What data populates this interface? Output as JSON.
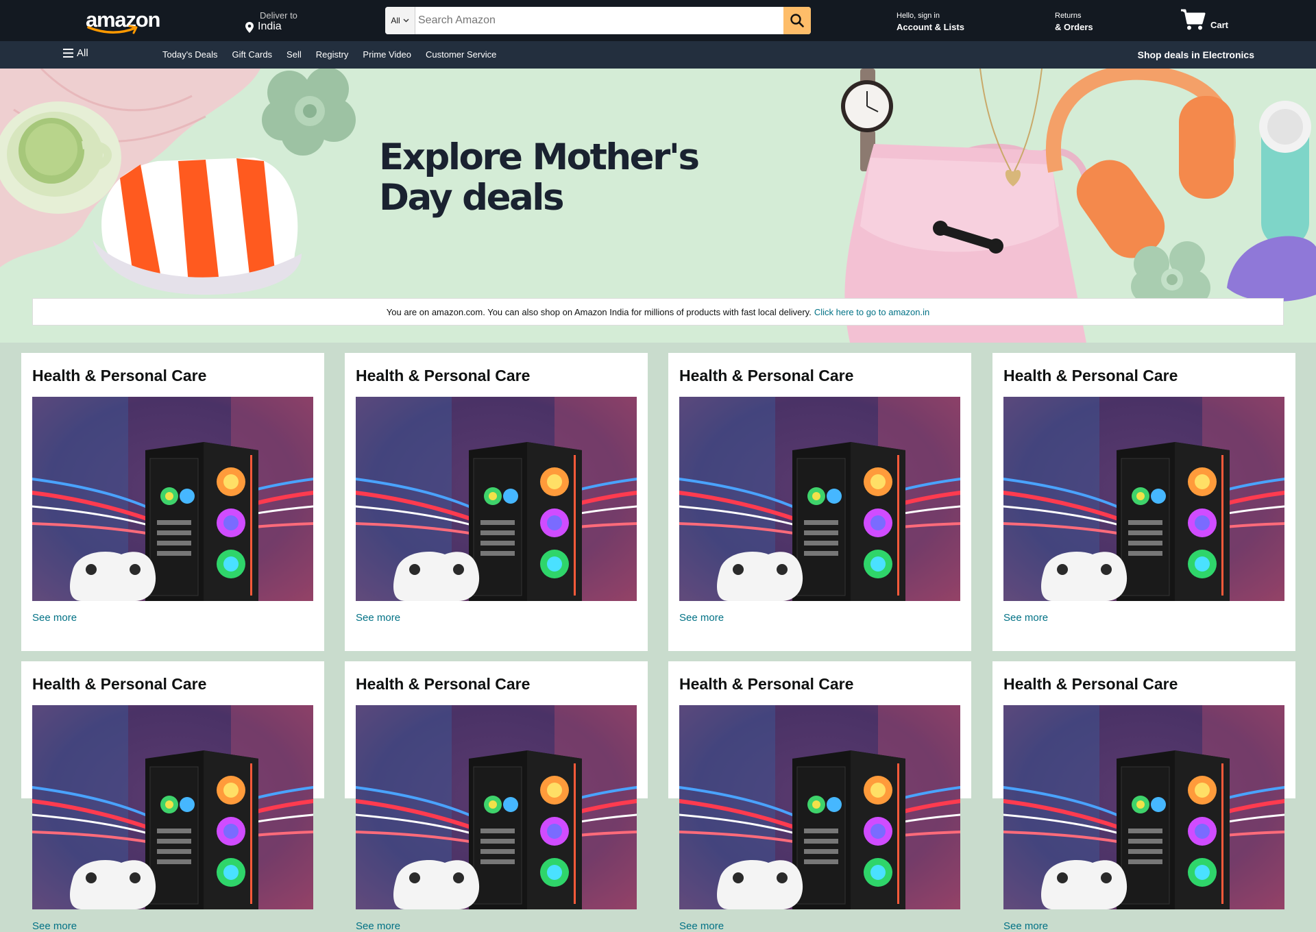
{
  "header": {
    "logo_text": "amazon",
    "deliver_to_label": "Deliver to",
    "deliver_to_location": "India",
    "search_category": "All",
    "search_placeholder": "Search Amazon",
    "account_greeting": "Hello, sign in",
    "account_label": "Account & Lists",
    "returns_label": "Returns",
    "orders_label": "& Orders",
    "cart_label": "Cart"
  },
  "subnav": {
    "all_label": "All",
    "links": [
      "Today's Deals",
      "Gift Cards",
      "Sell",
      "Registry",
      "Prime Video",
      "Customer Service"
    ],
    "promo": "Shop deals in Electronics"
  },
  "hero": {
    "title_line1": "Explore Mother's",
    "title_line2": "Day deals",
    "bg_color": "#d4ecd6"
  },
  "notice": {
    "text": "You are on amazon.com. You can also shop on Amazon India for millions of products with fast local delivery.",
    "link_text": "Click here to go to amazon.in"
  },
  "cards": [
    {
      "title": "Health & Personal Care",
      "link": "See more",
      "image": "gaming-pc-and-controller"
    },
    {
      "title": "Health & Personal Care",
      "link": "See more",
      "image": "gaming-pc-and-controller"
    },
    {
      "title": "Health & Personal Care",
      "link": "See more",
      "image": "gaming-pc-and-controller"
    },
    {
      "title": "Health & Personal Care",
      "link": "See more",
      "image": "gaming-pc-and-controller"
    },
    {
      "title": "Health & Personal Care",
      "link": "See more",
      "image": "gaming-pc-and-controller"
    },
    {
      "title": "Health & Personal Care",
      "link": "See more",
      "image": "gaming-pc-and-controller"
    },
    {
      "title": "Health & Personal Care",
      "link": "See more",
      "image": "gaming-pc-and-controller"
    },
    {
      "title": "Health & Personal Care",
      "link": "See more",
      "image": "gaming-pc-and-controller"
    }
  ],
  "colors": {
    "nav_dark": "#131921",
    "nav_sub": "#232f3e",
    "search_button": "#febd69",
    "link": "#007185",
    "page_bg": "#c9dccd"
  }
}
